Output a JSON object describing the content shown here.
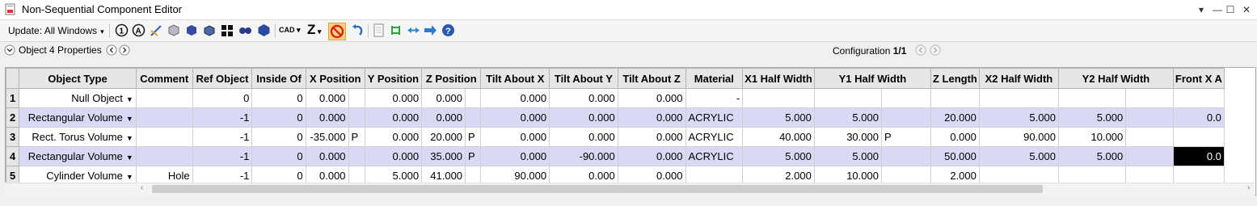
{
  "window": {
    "title": "Non-Sequential Component Editor"
  },
  "toolbar": {
    "update_label": "Update: All Windows",
    "cad_label": "CAD",
    "z_label": "Z"
  },
  "propbar": {
    "object_label": "Object 4 Properties",
    "config_label": "Configuration",
    "config_value": "1/1"
  },
  "table": {
    "headers": [
      "Object Type",
      "Comment",
      "Ref Object",
      "Inside Of",
      "X Position",
      "Y Position",
      "Z Position",
      "Tilt About X",
      "Tilt About Y",
      "Tilt About Z",
      "Material",
      "X1 Half Width",
      "Y1 Half Width",
      "Z Length",
      "X2 Half Width",
      "Y2 Half Width",
      "Front X A"
    ],
    "rows": [
      {
        "num": "1",
        "type": "Null Object",
        "comment": "",
        "ref": "0",
        "inside": "0",
        "xpos": "0.000",
        "xpos_flag": "",
        "ypos": "0.000",
        "zpos": "0.000",
        "zpos_flag": "",
        "tiltx": "0.000",
        "tilty": "0.000",
        "tiltz": "0.000",
        "material": "-",
        "x1": "",
        "y1": "",
        "y1_flag": "",
        "zlen": "",
        "x2": "",
        "y2": "",
        "frontx": ""
      },
      {
        "num": "2",
        "type": "Rectangular Volume",
        "comment": "",
        "ref": "-1",
        "inside": "0",
        "xpos": "0.000",
        "xpos_flag": "",
        "ypos": "0.000",
        "zpos": "0.000",
        "zpos_flag": "",
        "tiltx": "0.000",
        "tilty": "0.000",
        "tiltz": "0.000",
        "material": "ACRYLIC",
        "x1": "5.000",
        "y1": "5.000",
        "y1_flag": "",
        "zlen": "20.000",
        "x2": "5.000",
        "y2": "5.000",
        "frontx": "0.0"
      },
      {
        "num": "3",
        "type": "Rect. Torus Volume",
        "comment": "",
        "ref": "-1",
        "inside": "0",
        "xpos": "-35.000",
        "xpos_flag": "P",
        "ypos": "0.000",
        "zpos": "20.000",
        "zpos_flag": "P",
        "tiltx": "0.000",
        "tilty": "0.000",
        "tiltz": "0.000",
        "material": "ACRYLIC",
        "x1": "40.000",
        "y1": "30.000",
        "y1_flag": "P",
        "zlen": "0.000",
        "x2": "90.000",
        "y2": "10.000",
        "frontx": ""
      },
      {
        "num": "4",
        "type": "Rectangular Volume",
        "comment": "",
        "ref": "-1",
        "inside": "0",
        "xpos": "0.000",
        "xpos_flag": "",
        "ypos": "0.000",
        "zpos": "35.000",
        "zpos_flag": "P",
        "tiltx": "0.000",
        "tilty": "-90.000",
        "tiltz": "0.000",
        "material": "ACRYLIC",
        "x1": "5.000",
        "y1": "5.000",
        "y1_flag": "",
        "zlen": "50.000",
        "x2": "5.000",
        "y2": "5.000",
        "frontx": "0.0"
      },
      {
        "num": "5",
        "type": "Cylinder Volume",
        "comment": "Hole",
        "ref": "-1",
        "inside": "0",
        "xpos": "0.000",
        "xpos_flag": "",
        "ypos": "5.000",
        "zpos": "41.000",
        "zpos_flag": "",
        "tiltx": "90.000",
        "tilty": "0.000",
        "tiltz": "0.000",
        "material": "",
        "x1": "2.000",
        "y1": "10.000",
        "y1_flag": "",
        "zlen": "2.000",
        "x2": "",
        "y2": "",
        "frontx": ""
      }
    ]
  },
  "colors": {
    "selected_row": "#d9d9f5",
    "header_bg": "#e6e6e6",
    "highlight_cell": "#000000"
  }
}
